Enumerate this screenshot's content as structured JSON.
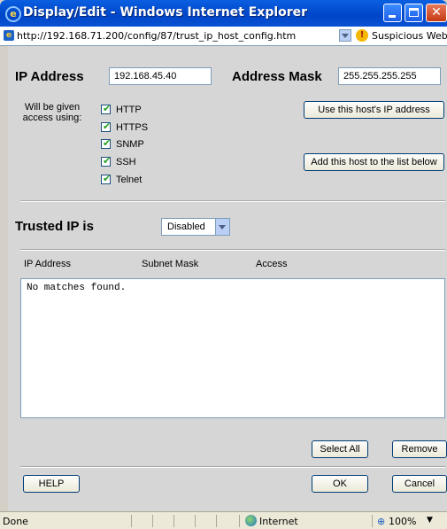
{
  "window": {
    "title": "Display/Edit - Windows Internet Explorer"
  },
  "address_bar": {
    "url": "http://192.168.71.200/config/87/trust_ip_host_config.htm",
    "security_status": "Suspicious Website"
  },
  "form": {
    "ip_address_label": "IP Address",
    "ip_address_value": "192.168.45.40",
    "address_mask_label": "Address Mask",
    "address_mask_value": "255.255.255.255",
    "access_label": "Will be given access using:",
    "protocols": [
      {
        "label": "HTTP",
        "checked": true
      },
      {
        "label": "HTTPS",
        "checked": true
      },
      {
        "label": "SNMP",
        "checked": true
      },
      {
        "label": "SSH",
        "checked": true
      },
      {
        "label": "Telnet",
        "checked": true
      }
    ],
    "use_host_ip_button": "Use this host's IP address",
    "add_host_button": "Add this host to the list below",
    "trusted_ip_label": "Trusted IP is",
    "trusted_ip_value": "Disabled"
  },
  "table": {
    "columns": [
      "IP Address",
      "Subnet Mask",
      "Access"
    ],
    "empty_message": "No matches found."
  },
  "buttons": {
    "select_all": "Select All",
    "remove": "Remove",
    "help": "HELP",
    "ok": "OK",
    "cancel": "Cancel"
  },
  "status_bar": {
    "status": "Done",
    "zone": "Internet",
    "zoom": "100%"
  },
  "icons": {
    "checkmark": "✔",
    "close": "✕",
    "dropdown": "▼"
  }
}
